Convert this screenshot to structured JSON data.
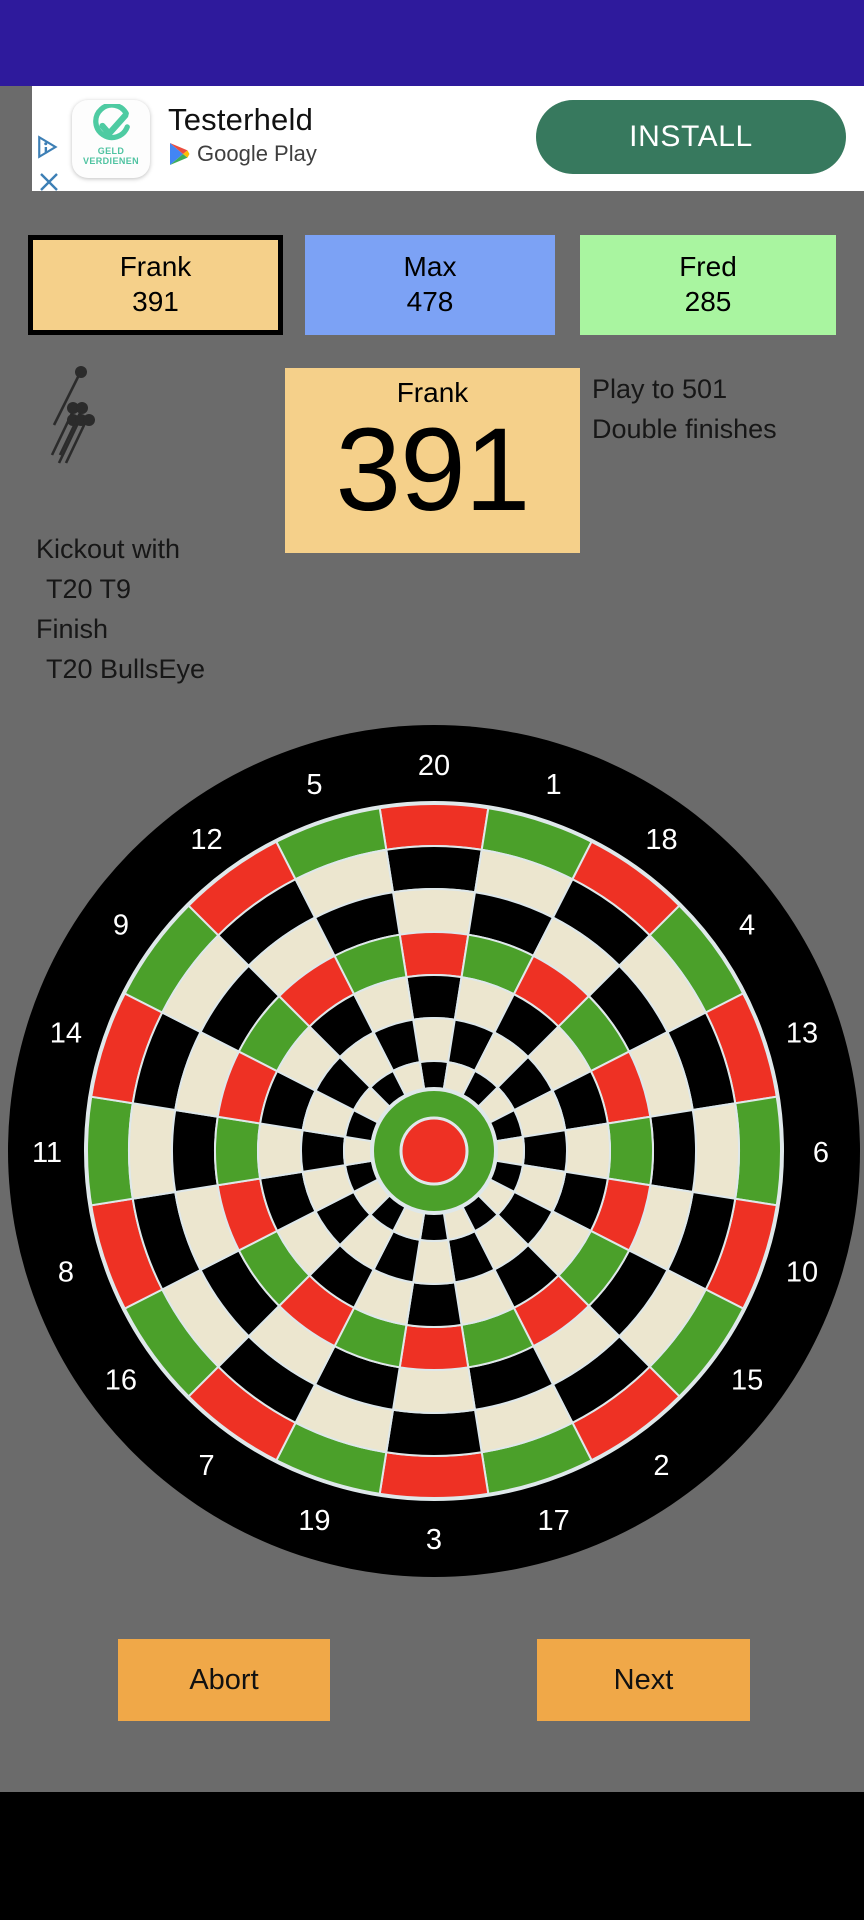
{
  "statusbar": {
    "color": "#2e1a9c"
  },
  "ad": {
    "app_name": "Testerheld",
    "store": "Google Play",
    "install_label": "INSTALL",
    "icon_sub_line1": "GELD",
    "icon_sub_line2": "VERDIENEN",
    "adchoices_icon": "adchoices-icon",
    "close_icon": "close-icon",
    "app_icon": "check-circle-icon",
    "store_icon": "google-play-icon",
    "install_color": "#37795e"
  },
  "players": [
    {
      "name": "Frank",
      "score": "391",
      "color": "#f5d08a",
      "active": true
    },
    {
      "name": "Max",
      "score": "478",
      "color": "#7ca2f5",
      "active": false
    },
    {
      "name": "Fred",
      "score": "285",
      "color": "#a9f5a0",
      "active": false
    }
  ],
  "current": {
    "name": "Frank",
    "score": "391",
    "color": "#f5d08a"
  },
  "hint": {
    "line1": "Kickout with",
    "line2": "T20 T9",
    "line3": "Finish",
    "line4": "T20 BullsEye"
  },
  "rules": {
    "line1": "Play to 501",
    "line2": "Double finishes"
  },
  "darts_icon": "three-darts-icon",
  "board": {
    "numbers": [
      20,
      1,
      18,
      4,
      13,
      6,
      10,
      15,
      2,
      17,
      3,
      19,
      7,
      16,
      8,
      11,
      14,
      9,
      12,
      5
    ],
    "ring_colors": {
      "outer_black": "#000000",
      "cream": "#ece6cf",
      "black": "#000000",
      "red": "#ee3124",
      "green": "#4ba02a",
      "wire": "#dfe8ea",
      "bull_outer": "#4ba02a",
      "bull_inner": "#ee3124"
    },
    "label_color": "#ffffff"
  },
  "buttons": {
    "abort": "Abort",
    "next": "Next",
    "color": "#f0a848"
  }
}
